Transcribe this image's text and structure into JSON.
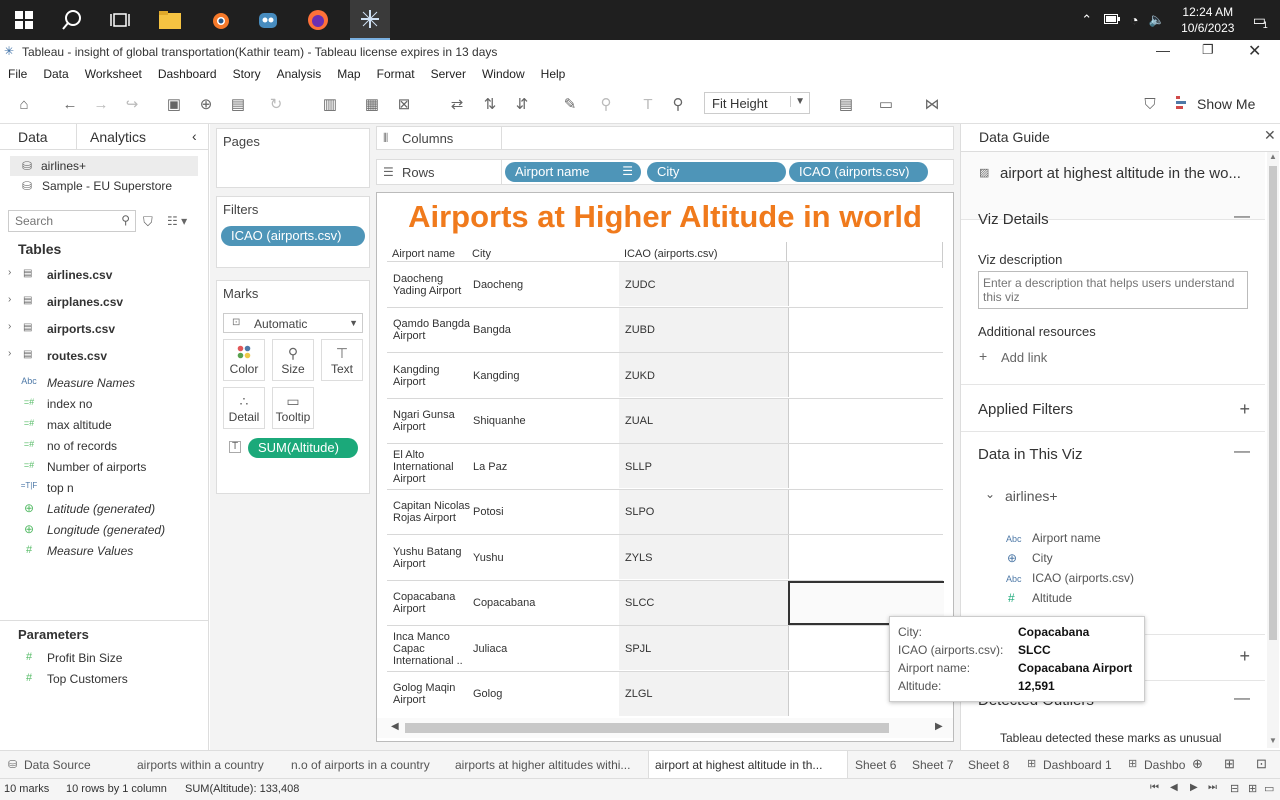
{
  "taskbar": {
    "time": "12:24 AM",
    "date": "10/6/2023",
    "notification_count": "1"
  },
  "window": {
    "title": "Tableau - insight of global transportation(Kathir team) - Tableau license expires in 13 days"
  },
  "menu": [
    "File",
    "Data",
    "Worksheet",
    "Dashboard",
    "Story",
    "Analysis",
    "Map",
    "Format",
    "Server",
    "Window",
    "Help"
  ],
  "toolbar": {
    "fit": "Fit Height",
    "show_me": "Show Me"
  },
  "sidebar": {
    "tab_data": "Data",
    "tab_analytics": "Analytics",
    "datasources": [
      "airlines+",
      "Sample - EU Superstore"
    ],
    "search_placeholder": "Search",
    "tables_header": "Tables",
    "tables": [
      "airlines.csv",
      "airplanes.csv",
      "airports.csv",
      "routes.csv"
    ],
    "fields": [
      {
        "type": "Abc",
        "label": "Measure Names"
      },
      {
        "type": "=#",
        "label": "index no"
      },
      {
        "type": "=#",
        "label": "max altitude"
      },
      {
        "type": "=#",
        "label": "no of records"
      },
      {
        "type": "=#",
        "label": "Number of airports"
      },
      {
        "type": "=T|F",
        "label": "top n"
      },
      {
        "type": "globe",
        "label": "Latitude (generated)"
      },
      {
        "type": "globe",
        "label": "Longitude (generated)"
      },
      {
        "type": "#",
        "label": "Measure Values"
      }
    ],
    "parameters_header": "Parameters",
    "parameters": [
      "Profit Bin Size",
      "Top Customers"
    ]
  },
  "shelves": {
    "pages": "Pages",
    "filters": "Filters",
    "filter_pill": "ICAO (airports.csv)",
    "marks": "Marks",
    "mark_type": "Automatic",
    "mark_buttons": [
      "Color",
      "Size",
      "Text",
      "Detail",
      "Tooltip"
    ],
    "mark_pill": "SUM(Altitude)",
    "columns": "Columns",
    "rows": "Rows",
    "row_pills": [
      "Airport name",
      "City",
      "ICAO (airports.csv)"
    ]
  },
  "view": {
    "title": "Airports at Higher Altitude in world",
    "headers": [
      "Airport name",
      "City",
      "ICAO (airports.csv)"
    ],
    "rows": [
      {
        "airport": "Daocheng Yading Airport",
        "city": "Daocheng",
        "icao": "ZUDC"
      },
      {
        "airport": "Qamdo Bangda Airport",
        "city": "Bangda",
        "icao": "ZUBD"
      },
      {
        "airport": "Kangding Airport",
        "city": "Kangding",
        "icao": "ZUKD"
      },
      {
        "airport": "Ngari Gunsa Airport",
        "city": "Shiquanhe",
        "icao": "ZUAL"
      },
      {
        "airport": "El Alto International Airport",
        "city": "La Paz",
        "icao": "SLLP"
      },
      {
        "airport": "Capitan Nicolas Rojas Airport",
        "city": "Potosi",
        "icao": "SLPO"
      },
      {
        "airport": "Yushu Batang Airport",
        "city": "Yushu",
        "icao": "ZYLS"
      },
      {
        "airport": "Copacabana Airport",
        "city": "Copacabana",
        "icao": "SLCC"
      },
      {
        "airport": "Inca Manco Capac International ..",
        "city": "Juliaca",
        "icao": "SPJL"
      },
      {
        "airport": "Golog Maqin Airport",
        "city": "Golog",
        "icao": "ZLGL"
      }
    ]
  },
  "tooltip": {
    "city_label": "City:",
    "city": "Copacabana",
    "icao_label": "ICAO (airports.csv):",
    "icao": "SLCC",
    "airport_label": "Airport name:",
    "airport": "Copacabana Airport",
    "altitude_label": "Altitude:",
    "altitude": "12,591"
  },
  "data_guide": {
    "header": "Data Guide",
    "sheet_title": "airport at highest altitude in the wo...",
    "viz_details": "Viz Details",
    "viz_description": "Viz description",
    "description_placeholder": "Enter a description that helps users understand this viz",
    "additional_resources": "Additional resources",
    "add_link": "Add link",
    "applied_filters": "Applied Filters",
    "data_in_viz": "Data in This Viz",
    "datasource": "airlines+",
    "fields": [
      {
        "type": "Abc",
        "label": "Airport name"
      },
      {
        "type": "globe",
        "label": "City"
      },
      {
        "type": "Abc",
        "label": "ICAO (airports.csv)"
      },
      {
        "type": "#",
        "label": "Altitude"
      }
    ],
    "detected_outliers": "Detected Outliers",
    "outlier_text": "Tableau detected these marks as unusual"
  },
  "sheet_tabs": [
    "Data Source",
    "airports within a country",
    "n.o of airports in a country",
    "airports at higher altitudes withi...",
    "airport at highest altitude in th...",
    "Sheet 6",
    "Sheet 7",
    "Sheet 8",
    "Dashboard 1",
    "Dashbo"
  ],
  "status": {
    "marks": "10 marks",
    "rows_cols": "10 rows by 1 column",
    "sum": "SUM(Altitude): 133,408"
  },
  "colors": {
    "title_orange": "#f07a1c",
    "pill_blue": "#4e95b8",
    "pill_green": "#1ba97a"
  }
}
